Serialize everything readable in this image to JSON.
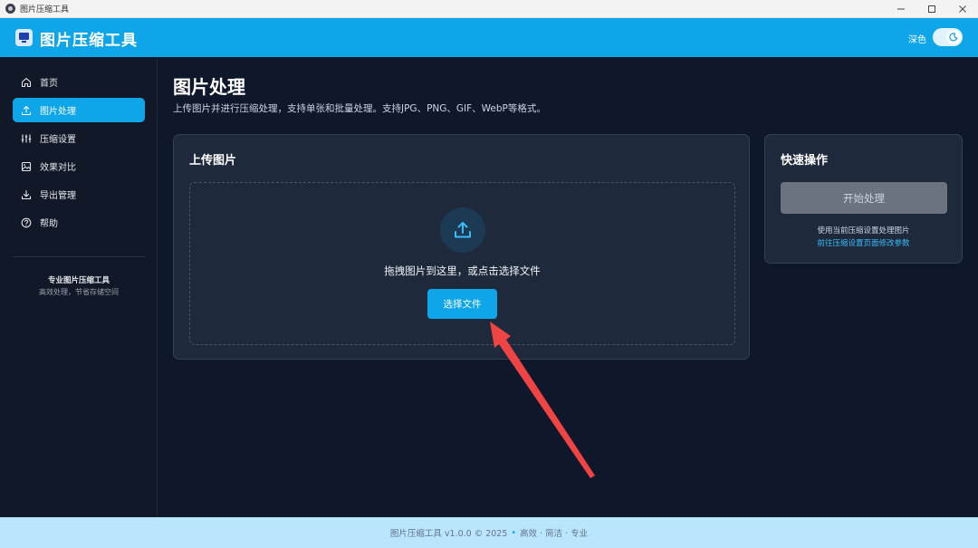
{
  "window": {
    "title": "图片压缩工具"
  },
  "header": {
    "brand": "图片压缩工具",
    "theme_label": "深色"
  },
  "sidebar": {
    "items": [
      {
        "label": "首页",
        "icon": "home-icon"
      },
      {
        "label": "图片处理",
        "icon": "upload-icon",
        "active": true
      },
      {
        "label": "压缩设置",
        "icon": "sliders-icon"
      },
      {
        "label": "效果对比",
        "icon": "image-compare-icon"
      },
      {
        "label": "导出管理",
        "icon": "download-icon"
      },
      {
        "label": "帮助",
        "icon": "help-icon"
      }
    ],
    "footer_title": "专业图片压缩工具",
    "footer_subtitle": "高效处理，节省存储空间"
  },
  "main": {
    "title": "图片处理",
    "description": "上传图片并进行压缩处理，支持单张和批量处理。支持JPG、PNG、GIF、WebP等格式。"
  },
  "upload": {
    "title": "上传图片",
    "drop_text": "拖拽图片到这里，或点击选择文件",
    "button": "选择文件"
  },
  "quick": {
    "title": "快速操作",
    "start_button": "开始处理",
    "info": "使用当前压缩设置处理图片",
    "link": "前往压缩设置页面修改参数"
  },
  "footer": {
    "text": "图片压缩工具 v1.0.0 © 2025",
    "tagline": "高效 · 简洁 · 专业"
  },
  "colors": {
    "accent": "#0ea5e9",
    "background": "#0f172a",
    "card": "#1e293b",
    "annotation": "#ef4444"
  }
}
